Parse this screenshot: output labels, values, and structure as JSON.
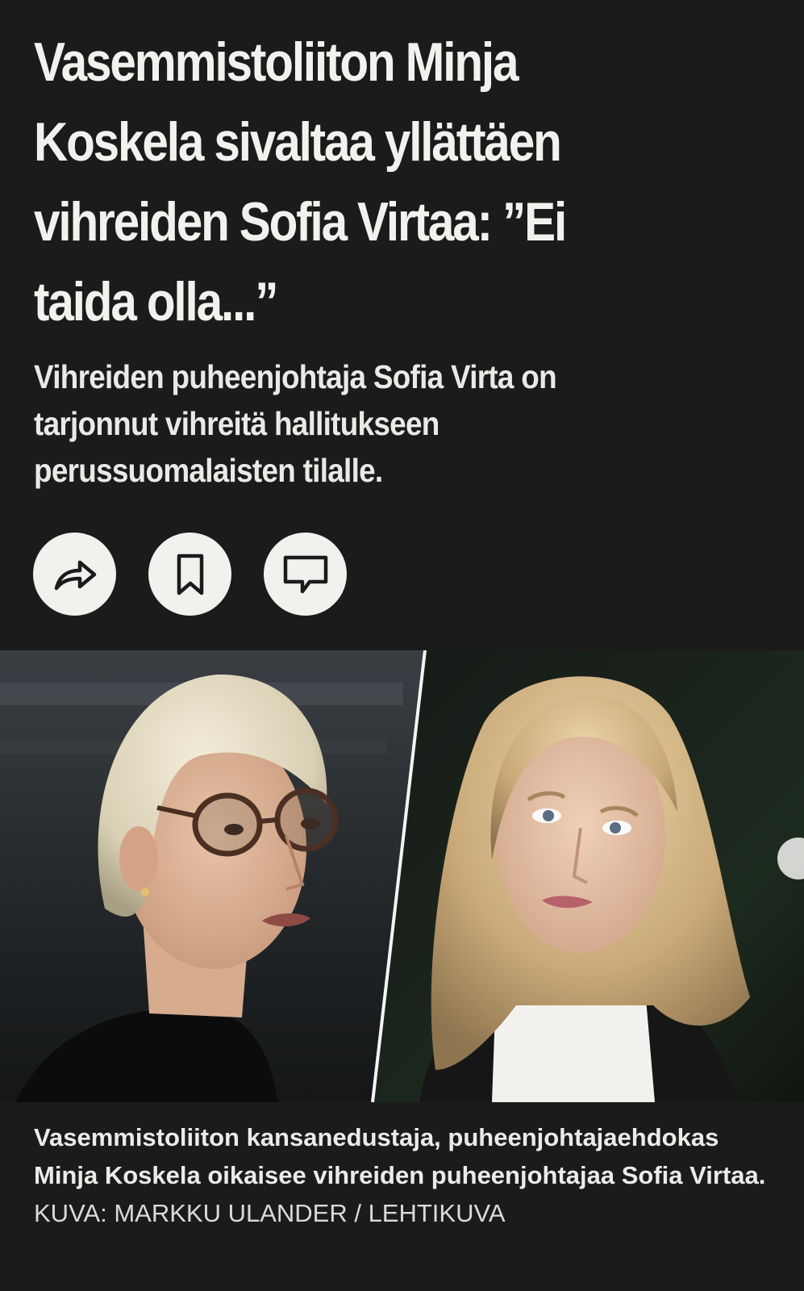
{
  "article": {
    "headline": "Vasemmistoliiton Minja Koskela sivaltaa yllättäen vihreiden Sofia Virtaa: ”Ei taida olla...”",
    "lead": "Vihreiden puheenjohtaja Sofia Virta on tarjonnut vihreitä hallitukseen perussuomalaisten tilalle."
  },
  "actions": [
    {
      "name": "share",
      "icon": "share-arrow-icon"
    },
    {
      "name": "bookmark",
      "icon": "bookmark-icon"
    },
    {
      "name": "comments",
      "icon": "comment-bubble-icon"
    }
  ],
  "photo": {
    "description_icon": "photo-collage"
  },
  "caption": {
    "text": "Vasemmistoliiton kansanedustaja, puheenjohtajaehdokas Minja Koskela oikaisee vihreiden puheenjohtajaa Sofia Virtaa.",
    "credit": "KUVA: MARKKU ULANDER / LEHTIKUVA"
  },
  "colors": {
    "background": "#1b1b1b",
    "text": "#f3f1ed",
    "button_bg": "#f3f1ee",
    "icon": "#1b1b1b"
  }
}
